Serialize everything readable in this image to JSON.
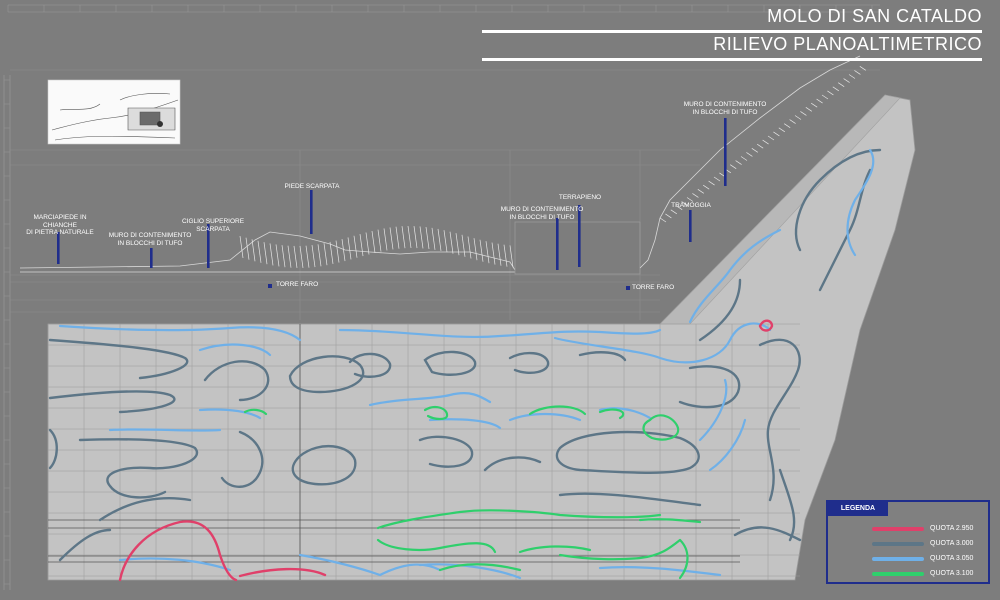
{
  "title": {
    "line1": "MOLO DI SAN CATALDO",
    "line2": "RILIEVO PLANOALTIMETRICO"
  },
  "section_labels": {
    "marciapiede": "MARCIAPIEDE IN CHIANCHE\nDI PIETRA NATURALE",
    "muro1": "MURO DI CONTENIMENTO\nIN BLOCCHI DI TUFO",
    "ciglio": "CIGLIO SUPERIORE SCARPATA",
    "piede": "PIEDE SCARPATA",
    "muro2": "MURO DI CONTENIMENTO\nIN BLOCCHI DI TUFO",
    "terrapieno": "TERRAPIENO",
    "tramoggia": "TRAMOGGIA",
    "muro3": "MURO DI CONTENIMENTO\nIN BLOCCHI DI TUFO",
    "torre1": "TORRE FARO",
    "torre2": "TORRE FARO"
  },
  "legend": {
    "title": "LEGENDA",
    "items": [
      {
        "label": "QUOTA 2.950",
        "color": "#e0406a"
      },
      {
        "label": "QUOTA 3.000",
        "color": "#5d7687"
      },
      {
        "label": "QUOTA 3.050",
        "color": "#6fb0e8"
      },
      {
        "label": "QUOTA 3.100",
        "color": "#2fcf6c"
      }
    ]
  },
  "colors": {
    "background": "#7d7d7d",
    "plan_fill": "#c3c3c3",
    "marker": "#1f2d8c"
  }
}
